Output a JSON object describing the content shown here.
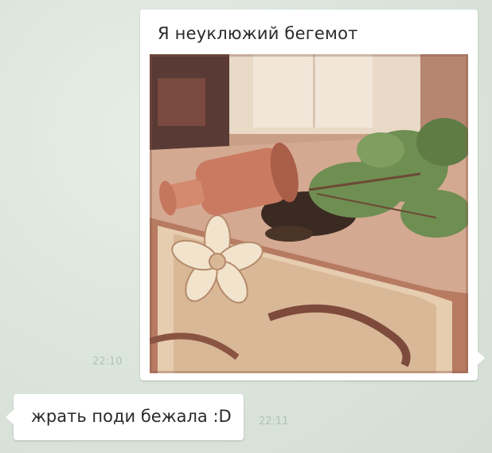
{
  "messages": [
    {
      "direction": "outgoing",
      "text": "Я неуклюжий бегемот",
      "time": "22:10",
      "has_photo": true
    },
    {
      "direction": "incoming",
      "text": "жрать поди бежала :D",
      "time": "22:11"
    }
  ],
  "colors": {
    "background": "#dde7de",
    "bubble": "#ffffff",
    "timestamp": "#b5c1b5",
    "text": "#2a2a2a"
  }
}
